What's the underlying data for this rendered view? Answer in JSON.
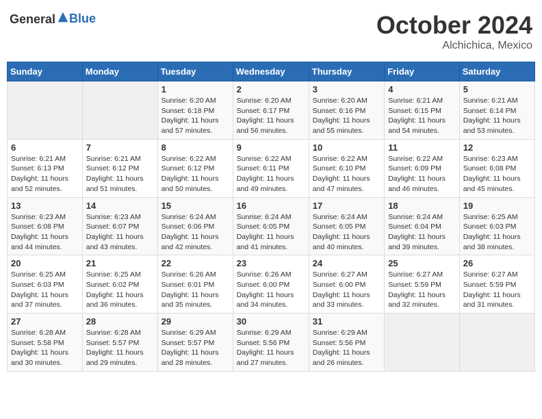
{
  "header": {
    "logo_general": "General",
    "logo_blue": "Blue",
    "month": "October 2024",
    "location": "Alchichica, Mexico"
  },
  "days_of_week": [
    "Sunday",
    "Monday",
    "Tuesday",
    "Wednesday",
    "Thursday",
    "Friday",
    "Saturday"
  ],
  "weeks": [
    [
      {
        "day": "",
        "info": ""
      },
      {
        "day": "",
        "info": ""
      },
      {
        "day": "1",
        "sunrise": "Sunrise: 6:20 AM",
        "sunset": "Sunset: 6:18 PM",
        "daylight": "Daylight: 11 hours and 57 minutes."
      },
      {
        "day": "2",
        "sunrise": "Sunrise: 6:20 AM",
        "sunset": "Sunset: 6:17 PM",
        "daylight": "Daylight: 11 hours and 56 minutes."
      },
      {
        "day": "3",
        "sunrise": "Sunrise: 6:20 AM",
        "sunset": "Sunset: 6:16 PM",
        "daylight": "Daylight: 11 hours and 55 minutes."
      },
      {
        "day": "4",
        "sunrise": "Sunrise: 6:21 AM",
        "sunset": "Sunset: 6:15 PM",
        "daylight": "Daylight: 11 hours and 54 minutes."
      },
      {
        "day": "5",
        "sunrise": "Sunrise: 6:21 AM",
        "sunset": "Sunset: 6:14 PM",
        "daylight": "Daylight: 11 hours and 53 minutes."
      }
    ],
    [
      {
        "day": "6",
        "sunrise": "Sunrise: 6:21 AM",
        "sunset": "Sunset: 6:13 PM",
        "daylight": "Daylight: 11 hours and 52 minutes."
      },
      {
        "day": "7",
        "sunrise": "Sunrise: 6:21 AM",
        "sunset": "Sunset: 6:12 PM",
        "daylight": "Daylight: 11 hours and 51 minutes."
      },
      {
        "day": "8",
        "sunrise": "Sunrise: 6:22 AM",
        "sunset": "Sunset: 6:12 PM",
        "daylight": "Daylight: 11 hours and 50 minutes."
      },
      {
        "day": "9",
        "sunrise": "Sunrise: 6:22 AM",
        "sunset": "Sunset: 6:11 PM",
        "daylight": "Daylight: 11 hours and 49 minutes."
      },
      {
        "day": "10",
        "sunrise": "Sunrise: 6:22 AM",
        "sunset": "Sunset: 6:10 PM",
        "daylight": "Daylight: 11 hours and 47 minutes."
      },
      {
        "day": "11",
        "sunrise": "Sunrise: 6:22 AM",
        "sunset": "Sunset: 6:09 PM",
        "daylight": "Daylight: 11 hours and 46 minutes."
      },
      {
        "day": "12",
        "sunrise": "Sunrise: 6:23 AM",
        "sunset": "Sunset: 6:08 PM",
        "daylight": "Daylight: 11 hours and 45 minutes."
      }
    ],
    [
      {
        "day": "13",
        "sunrise": "Sunrise: 6:23 AM",
        "sunset": "Sunset: 6:08 PM",
        "daylight": "Daylight: 11 hours and 44 minutes."
      },
      {
        "day": "14",
        "sunrise": "Sunrise: 6:23 AM",
        "sunset": "Sunset: 6:07 PM",
        "daylight": "Daylight: 11 hours and 43 minutes."
      },
      {
        "day": "15",
        "sunrise": "Sunrise: 6:24 AM",
        "sunset": "Sunset: 6:06 PM",
        "daylight": "Daylight: 11 hours and 42 minutes."
      },
      {
        "day": "16",
        "sunrise": "Sunrise: 6:24 AM",
        "sunset": "Sunset: 6:05 PM",
        "daylight": "Daylight: 11 hours and 41 minutes."
      },
      {
        "day": "17",
        "sunrise": "Sunrise: 6:24 AM",
        "sunset": "Sunset: 6:05 PM",
        "daylight": "Daylight: 11 hours and 40 minutes."
      },
      {
        "day": "18",
        "sunrise": "Sunrise: 6:24 AM",
        "sunset": "Sunset: 6:04 PM",
        "daylight": "Daylight: 11 hours and 39 minutes."
      },
      {
        "day": "19",
        "sunrise": "Sunrise: 6:25 AM",
        "sunset": "Sunset: 6:03 PM",
        "daylight": "Daylight: 11 hours and 38 minutes."
      }
    ],
    [
      {
        "day": "20",
        "sunrise": "Sunrise: 6:25 AM",
        "sunset": "Sunset: 6:03 PM",
        "daylight": "Daylight: 11 hours and 37 minutes."
      },
      {
        "day": "21",
        "sunrise": "Sunrise: 6:25 AM",
        "sunset": "Sunset: 6:02 PM",
        "daylight": "Daylight: 11 hours and 36 minutes."
      },
      {
        "day": "22",
        "sunrise": "Sunrise: 6:26 AM",
        "sunset": "Sunset: 6:01 PM",
        "daylight": "Daylight: 11 hours and 35 minutes."
      },
      {
        "day": "23",
        "sunrise": "Sunrise: 6:26 AM",
        "sunset": "Sunset: 6:00 PM",
        "daylight": "Daylight: 11 hours and 34 minutes."
      },
      {
        "day": "24",
        "sunrise": "Sunrise: 6:27 AM",
        "sunset": "Sunset: 6:00 PM",
        "daylight": "Daylight: 11 hours and 33 minutes."
      },
      {
        "day": "25",
        "sunrise": "Sunrise: 6:27 AM",
        "sunset": "Sunset: 5:59 PM",
        "daylight": "Daylight: 11 hours and 32 minutes."
      },
      {
        "day": "26",
        "sunrise": "Sunrise: 6:27 AM",
        "sunset": "Sunset: 5:59 PM",
        "daylight": "Daylight: 11 hours and 31 minutes."
      }
    ],
    [
      {
        "day": "27",
        "sunrise": "Sunrise: 6:28 AM",
        "sunset": "Sunset: 5:58 PM",
        "daylight": "Daylight: 11 hours and 30 minutes."
      },
      {
        "day": "28",
        "sunrise": "Sunrise: 6:28 AM",
        "sunset": "Sunset: 5:57 PM",
        "daylight": "Daylight: 11 hours and 29 minutes."
      },
      {
        "day": "29",
        "sunrise": "Sunrise: 6:29 AM",
        "sunset": "Sunset: 5:57 PM",
        "daylight": "Daylight: 11 hours and 28 minutes."
      },
      {
        "day": "30",
        "sunrise": "Sunrise: 6:29 AM",
        "sunset": "Sunset: 5:56 PM",
        "daylight": "Daylight: 11 hours and 27 minutes."
      },
      {
        "day": "31",
        "sunrise": "Sunrise: 6:29 AM",
        "sunset": "Sunset: 5:56 PM",
        "daylight": "Daylight: 11 hours and 26 minutes."
      },
      {
        "day": "",
        "info": ""
      },
      {
        "day": "",
        "info": ""
      }
    ]
  ]
}
